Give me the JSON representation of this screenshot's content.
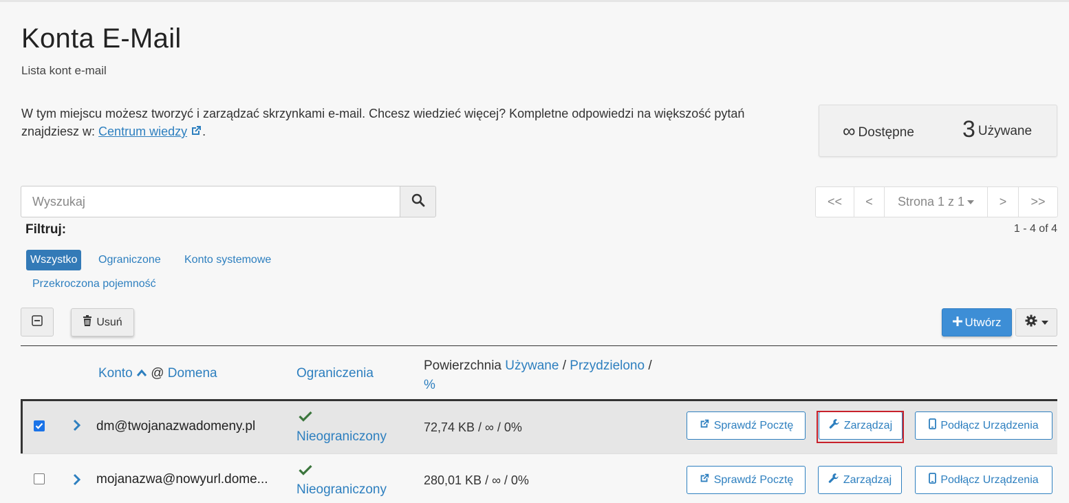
{
  "page": {
    "title": "Konta E-Mail",
    "subtitle": "Lista kont e-mail"
  },
  "intro": {
    "text": "W tym miejscu możesz tworzyć i zarządzać skrzynkami e-mail. Chcesz wiedzieć więcej? Kompletne odpowiedzi na większość pytań znajdziesz w: ",
    "link_text": "Centrum wiedzy",
    "suffix": "."
  },
  "stats": {
    "available_value": "∞",
    "available_label": "Dostępne",
    "used_value": "3",
    "used_label": "Używane"
  },
  "search": {
    "placeholder": "Wyszukaj",
    "icon": "search-icon"
  },
  "pagination": {
    "first": "<<",
    "prev": "<",
    "page_label": "Strona 1 z 1",
    "next": ">",
    "last": ">>",
    "result_count": "1 - 4 of 4"
  },
  "filters": {
    "label": "Filtruj:",
    "items": [
      {
        "label": "Wszystko",
        "active": true
      },
      {
        "label": "Ograniczone",
        "active": false
      },
      {
        "label": "Konto systemowe",
        "active": false
      },
      {
        "label": "Przekroczona pojemność",
        "active": false
      }
    ]
  },
  "toolbar": {
    "delete_label": "Usuń",
    "create_label": "Utwórz"
  },
  "table": {
    "headers": {
      "account": "Konto",
      "at": "@",
      "domain": "Domena",
      "limits": "Ograniczenia",
      "space_prefix": "Powierzchnia",
      "used": "Używane",
      "allocated": "Przydzielono",
      "slash": "/",
      "percent": "%"
    },
    "rows": [
      {
        "checked": true,
        "account": "dm@twojanazwadomeny.pl",
        "limit": "Nieograniczony",
        "usage": "72,74 KB / ∞ / 0%",
        "check_mail": "Sprawdź Pocztę",
        "manage": "Zarządzaj",
        "connect": "Podłącz Urządzenia"
      },
      {
        "checked": false,
        "account": "mojanazwa@nowyurl.dome...",
        "limit": "Nieograniczony",
        "usage": "280,01 KB / ∞ / 0%",
        "check_mail": "Sprawdź Pocztę",
        "manage": "Zarządzaj",
        "connect": "Podłącz Urządzenia"
      }
    ]
  },
  "colors": {
    "accent": "#2d7fbf",
    "primary_button": "#3d8ed6",
    "check_green": "#3c763d",
    "highlight_red": "#c8202a"
  }
}
